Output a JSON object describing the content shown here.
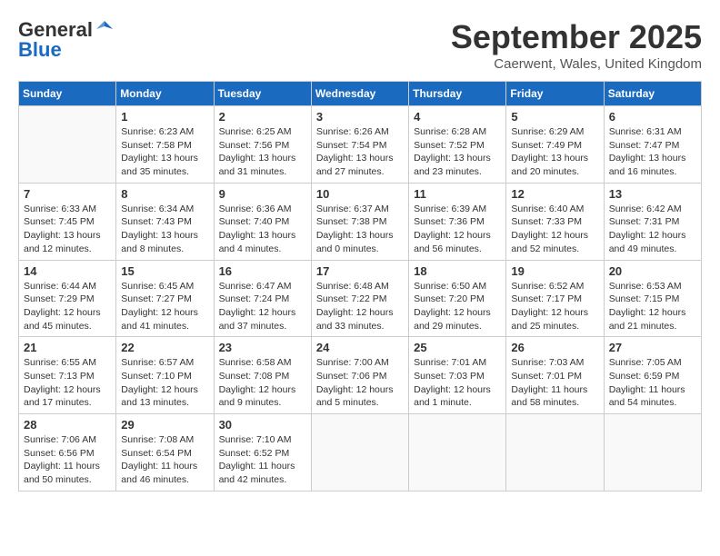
{
  "logo": {
    "general": "General",
    "blue": "Blue"
  },
  "title": "September 2025",
  "location": "Caerwent, Wales, United Kingdom",
  "weekdays": [
    "Sunday",
    "Monday",
    "Tuesday",
    "Wednesday",
    "Thursday",
    "Friday",
    "Saturday"
  ],
  "weeks": [
    [
      {
        "day": "",
        "info": ""
      },
      {
        "day": "1",
        "info": "Sunrise: 6:23 AM\nSunset: 7:58 PM\nDaylight: 13 hours\nand 35 minutes."
      },
      {
        "day": "2",
        "info": "Sunrise: 6:25 AM\nSunset: 7:56 PM\nDaylight: 13 hours\nand 31 minutes."
      },
      {
        "day": "3",
        "info": "Sunrise: 6:26 AM\nSunset: 7:54 PM\nDaylight: 13 hours\nand 27 minutes."
      },
      {
        "day": "4",
        "info": "Sunrise: 6:28 AM\nSunset: 7:52 PM\nDaylight: 13 hours\nand 23 minutes."
      },
      {
        "day": "5",
        "info": "Sunrise: 6:29 AM\nSunset: 7:49 PM\nDaylight: 13 hours\nand 20 minutes."
      },
      {
        "day": "6",
        "info": "Sunrise: 6:31 AM\nSunset: 7:47 PM\nDaylight: 13 hours\nand 16 minutes."
      }
    ],
    [
      {
        "day": "7",
        "info": "Sunrise: 6:33 AM\nSunset: 7:45 PM\nDaylight: 13 hours\nand 12 minutes."
      },
      {
        "day": "8",
        "info": "Sunrise: 6:34 AM\nSunset: 7:43 PM\nDaylight: 13 hours\nand 8 minutes."
      },
      {
        "day": "9",
        "info": "Sunrise: 6:36 AM\nSunset: 7:40 PM\nDaylight: 13 hours\nand 4 minutes."
      },
      {
        "day": "10",
        "info": "Sunrise: 6:37 AM\nSunset: 7:38 PM\nDaylight: 13 hours\nand 0 minutes."
      },
      {
        "day": "11",
        "info": "Sunrise: 6:39 AM\nSunset: 7:36 PM\nDaylight: 12 hours\nand 56 minutes."
      },
      {
        "day": "12",
        "info": "Sunrise: 6:40 AM\nSunset: 7:33 PM\nDaylight: 12 hours\nand 52 minutes."
      },
      {
        "day": "13",
        "info": "Sunrise: 6:42 AM\nSunset: 7:31 PM\nDaylight: 12 hours\nand 49 minutes."
      }
    ],
    [
      {
        "day": "14",
        "info": "Sunrise: 6:44 AM\nSunset: 7:29 PM\nDaylight: 12 hours\nand 45 minutes."
      },
      {
        "day": "15",
        "info": "Sunrise: 6:45 AM\nSunset: 7:27 PM\nDaylight: 12 hours\nand 41 minutes."
      },
      {
        "day": "16",
        "info": "Sunrise: 6:47 AM\nSunset: 7:24 PM\nDaylight: 12 hours\nand 37 minutes."
      },
      {
        "day": "17",
        "info": "Sunrise: 6:48 AM\nSunset: 7:22 PM\nDaylight: 12 hours\nand 33 minutes."
      },
      {
        "day": "18",
        "info": "Sunrise: 6:50 AM\nSunset: 7:20 PM\nDaylight: 12 hours\nand 29 minutes."
      },
      {
        "day": "19",
        "info": "Sunrise: 6:52 AM\nSunset: 7:17 PM\nDaylight: 12 hours\nand 25 minutes."
      },
      {
        "day": "20",
        "info": "Sunrise: 6:53 AM\nSunset: 7:15 PM\nDaylight: 12 hours\nand 21 minutes."
      }
    ],
    [
      {
        "day": "21",
        "info": "Sunrise: 6:55 AM\nSunset: 7:13 PM\nDaylight: 12 hours\nand 17 minutes."
      },
      {
        "day": "22",
        "info": "Sunrise: 6:57 AM\nSunset: 7:10 PM\nDaylight: 12 hours\nand 13 minutes."
      },
      {
        "day": "23",
        "info": "Sunrise: 6:58 AM\nSunset: 7:08 PM\nDaylight: 12 hours\nand 9 minutes."
      },
      {
        "day": "24",
        "info": "Sunrise: 7:00 AM\nSunset: 7:06 PM\nDaylight: 12 hours\nand 5 minutes."
      },
      {
        "day": "25",
        "info": "Sunrise: 7:01 AM\nSunset: 7:03 PM\nDaylight: 12 hours\nand 1 minute."
      },
      {
        "day": "26",
        "info": "Sunrise: 7:03 AM\nSunset: 7:01 PM\nDaylight: 11 hours\nand 58 minutes."
      },
      {
        "day": "27",
        "info": "Sunrise: 7:05 AM\nSunset: 6:59 PM\nDaylight: 11 hours\nand 54 minutes."
      }
    ],
    [
      {
        "day": "28",
        "info": "Sunrise: 7:06 AM\nSunset: 6:56 PM\nDaylight: 11 hours\nand 50 minutes."
      },
      {
        "day": "29",
        "info": "Sunrise: 7:08 AM\nSunset: 6:54 PM\nDaylight: 11 hours\nand 46 minutes."
      },
      {
        "day": "30",
        "info": "Sunrise: 7:10 AM\nSunset: 6:52 PM\nDaylight: 11 hours\nand 42 minutes."
      },
      {
        "day": "",
        "info": ""
      },
      {
        "day": "",
        "info": ""
      },
      {
        "day": "",
        "info": ""
      },
      {
        "day": "",
        "info": ""
      }
    ]
  ]
}
